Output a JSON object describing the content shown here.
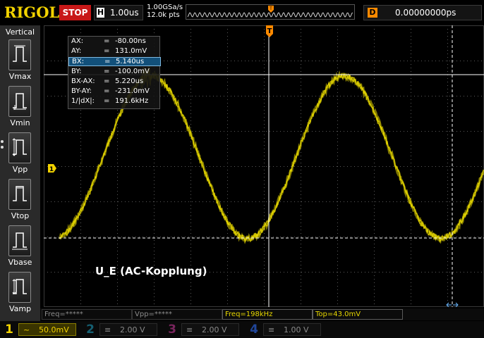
{
  "header": {
    "brand": "RIGOL",
    "run_state": "STOP",
    "timebase_label": "H",
    "timebase_value": "1.00us",
    "sample_rate": "1.00GSa/s",
    "memory_depth": "12.0k pts",
    "trigger_marker": "T",
    "delay_label": "D",
    "delay_value": "0.00000000ps"
  },
  "left_panel": {
    "title": "Vertical",
    "items": [
      {
        "label": "Vmax",
        "icon": "vmax-icon"
      },
      {
        "label": "Vmin",
        "icon": "vmin-icon"
      },
      {
        "label": "Vpp",
        "icon": "vpp-icon"
      },
      {
        "label": "Vtop",
        "icon": "vtop-icon"
      },
      {
        "label": "Vbase",
        "icon": "vbase-icon"
      },
      {
        "label": "Vamp",
        "icon": "vamp-icon"
      }
    ]
  },
  "cursor_readout": [
    {
      "key": "AX:",
      "eq": "=",
      "value": "-80.00ns",
      "selected": false
    },
    {
      "key": "AY:",
      "eq": "=",
      "value": "131.0mV",
      "selected": false
    },
    {
      "key": "BX:",
      "eq": "=",
      "value": "5.140us",
      "selected": true
    },
    {
      "key": "BY:",
      "eq": "=",
      "value": "-100.0mV",
      "selected": false
    },
    {
      "key": "BX-AX:",
      "eq": "=",
      "value": "5.220us",
      "selected": false
    },
    {
      "key": "BY-AY:",
      "eq": "=",
      "value": "-231.0mV",
      "selected": false
    },
    {
      "key": "1/|dX|:",
      "eq": "=",
      "value": "191.6kHz",
      "selected": false
    }
  ],
  "screen": {
    "annotation": "U_E (AC-Kopplung)",
    "channel_marker": "1",
    "trace_color": "#e8d800",
    "grid_color": "#5a5a5a",
    "cursor_color": "#ffffff",
    "trigger_color": "#ff8a00",
    "waveform": {
      "cycles_on_screen": 2.2,
      "peak_mV": 131,
      "trough_mV": -100,
      "volts_per_div_mV": 50
    }
  },
  "measurements": [
    {
      "label": "Freq=*****",
      "active": false
    },
    {
      "label": "Vpp=*****",
      "active": false
    },
    {
      "label": "Freq=198kHz",
      "active": true
    },
    {
      "label": "Top=43.0mV",
      "active": true
    }
  ],
  "channels": [
    {
      "num": "1",
      "coupling": "~",
      "scale": "50.0mV",
      "color": "#f2d200",
      "active": true
    },
    {
      "num": "2",
      "coupling": "≡",
      "scale": "2.00 V",
      "color": "#1ea6c8",
      "active": false
    },
    {
      "num": "3",
      "coupling": "≡",
      "scale": "2.00 V",
      "color": "#d23aa0",
      "active": false
    },
    {
      "num": "4",
      "coupling": "≡",
      "scale": "1.00 V",
      "color": "#2a60d8",
      "active": false
    }
  ]
}
